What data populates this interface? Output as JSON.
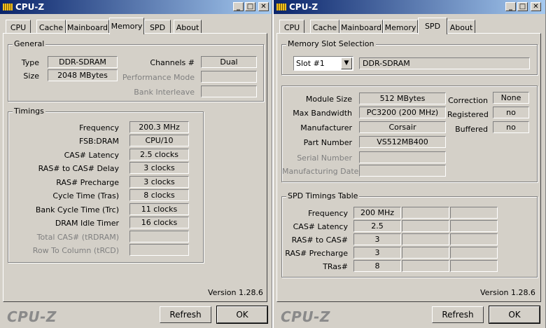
{
  "left": {
    "title": "CPU-Z",
    "tabs": [
      "CPU",
      "Cache",
      "Mainboard",
      "Memory",
      "SPD",
      "About"
    ],
    "active_tab": "Memory",
    "general": {
      "label": "General",
      "type_label": "Type",
      "type_value": "DDR-SDRAM",
      "size_label": "Size",
      "size_value": "2048 MBytes",
      "channels_label": "Channels #",
      "channels_value": "Dual",
      "perf_mode_label": "Performance Mode",
      "perf_mode_value": "",
      "bank_interleave_label": "Bank Interleave",
      "bank_interleave_value": ""
    },
    "timings": {
      "label": "Timings",
      "rows": [
        {
          "label": "Frequency",
          "value": "200.3 MHz",
          "dim": false
        },
        {
          "label": "FSB:DRAM",
          "value": "CPU/10",
          "dim": false
        },
        {
          "label": "CAS# Latency",
          "value": "2.5 clocks",
          "dim": false
        },
        {
          "label": "RAS# to CAS# Delay",
          "value": "3 clocks",
          "dim": false
        },
        {
          "label": "RAS# Precharge",
          "value": "3 clocks",
          "dim": false
        },
        {
          "label": "Cycle Time (Tras)",
          "value": "8 clocks",
          "dim": false
        },
        {
          "label": "Bank Cycle Time (Trc)",
          "value": "11 clocks",
          "dim": false
        },
        {
          "label": "DRAM Idle Timer",
          "value": "16 clocks",
          "dim": false
        },
        {
          "label": "Total CAS# (tRDRAM)",
          "value": "",
          "dim": true
        },
        {
          "label": "Row To Column (tRCD)",
          "value": "",
          "dim": true
        }
      ]
    },
    "version": "Version 1.28.6",
    "brand": "CPU-Z",
    "refresh": "Refresh",
    "ok": "OK"
  },
  "right": {
    "title": "CPU-Z",
    "tabs": [
      "CPU",
      "Cache",
      "Mainboard",
      "Memory",
      "SPD",
      "About"
    ],
    "active_tab": "SPD",
    "slot_group_label": "Memory Slot Selection",
    "slot_value": "Slot #1",
    "slot_type": "DDR-SDRAM",
    "module": {
      "rows": [
        {
          "label": "Module Size",
          "value": "512 MBytes",
          "dim": false
        },
        {
          "label": "Max Bandwidth",
          "value": "PC3200 (200 MHz)",
          "dim": false
        },
        {
          "label": "Manufacturer",
          "value": "Corsair",
          "dim": false
        },
        {
          "label": "Part Number",
          "value": "VS512MB400",
          "dim": false
        },
        {
          "label": "Serial Number",
          "value": "",
          "dim": true
        },
        {
          "label": "Manufacturing Date",
          "value": "",
          "dim": true
        }
      ],
      "flags": [
        {
          "label": "Correction",
          "value": "None"
        },
        {
          "label": "Registered",
          "value": "no"
        },
        {
          "label": "Buffered",
          "value": "no"
        }
      ]
    },
    "spd_timings": {
      "label": "SPD Timings Table",
      "rows": [
        {
          "label": "Frequency",
          "values": [
            "200 MHz",
            "",
            ""
          ]
        },
        {
          "label": "CAS# Latency",
          "values": [
            "2.5",
            "",
            ""
          ]
        },
        {
          "label": "RAS# to CAS#",
          "values": [
            "3",
            "",
            ""
          ]
        },
        {
          "label": "RAS# Precharge",
          "values": [
            "3",
            "",
            ""
          ]
        },
        {
          "label": "TRas#",
          "values": [
            "8",
            "",
            ""
          ]
        }
      ]
    },
    "version": "Version 1.28.6",
    "brand": "CPU-Z",
    "refresh": "Refresh",
    "ok": "OK"
  }
}
